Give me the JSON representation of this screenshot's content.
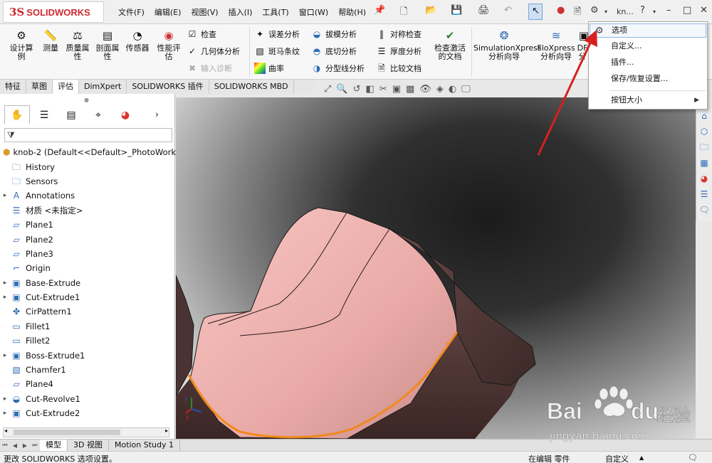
{
  "app": {
    "logo_ds": "3S",
    "logo_text": "SOLIDWORKS",
    "menus": [
      "文件(F)",
      "编辑(E)",
      "视图(V)",
      "插入(I)",
      "工具(T)",
      "窗口(W)",
      "帮助(H)"
    ],
    "user": "kn...",
    "help": "?"
  },
  "ribbon": {
    "big_tools": [
      {
        "label": "设计算\n例",
        "icon": "design-study-icon"
      },
      {
        "label": "测量",
        "icon": "measure-icon"
      },
      {
        "label": "质量属\n性",
        "icon": "mass-properties-icon"
      },
      {
        "label": "剖面属\n性",
        "icon": "section-properties-icon"
      },
      {
        "label": "传感器",
        "icon": "sensor-icon"
      },
      {
        "label": "性能评\n估",
        "icon": "performance-evaluation-icon"
      }
    ],
    "check_group": [
      {
        "label": "检查",
        "icon": "check-icon"
      },
      {
        "label": "几何体分析",
        "icon": "geometry-analysis-icon"
      },
      {
        "label": "输入诊断",
        "icon": "import-diagnostics-icon",
        "disabled": true
      }
    ],
    "analysis_col1": [
      {
        "label": "误差分析",
        "icon": "deviation-analysis-icon"
      },
      {
        "label": "斑马条纹",
        "icon": "zebra-stripes-icon"
      },
      {
        "label": "曲率",
        "icon": "curvature-icon"
      }
    ],
    "analysis_col2": [
      {
        "label": "拔模分析",
        "icon": "draft-analysis-icon"
      },
      {
        "label": "底切分析",
        "icon": "undercut-analysis-icon"
      },
      {
        "label": "分型线分析",
        "icon": "parting-line-analysis-icon"
      }
    ],
    "analysis_col3": [
      {
        "label": "对称检查",
        "icon": "symmetry-check-icon"
      },
      {
        "label": "厚度分析",
        "icon": "thickness-analysis-icon"
      },
      {
        "label": "比较文档",
        "icon": "compare-documents-icon"
      }
    ],
    "check_active_doc": "检查激活\n的文档",
    "simxpress": "SimulationXpress\n分析向导",
    "floxpress": "FloXpress\n分析向导",
    "dfm": "DF\n分"
  },
  "tabs": [
    {
      "label": "特征",
      "active": false
    },
    {
      "label": "草图",
      "active": false
    },
    {
      "label": "评估",
      "active": true
    },
    {
      "label": "DimXpert",
      "active": false
    },
    {
      "label": "SOLIDWORKS 插件",
      "active": false
    },
    {
      "label": "SOLIDWORKS MBD",
      "active": false
    }
  ],
  "feature_tree": {
    "root": "knob-2  (Default<<Default>_PhotoWork",
    "items": [
      {
        "label": "History",
        "icon": "history-folder-icon",
        "expandable": false
      },
      {
        "label": "Sensors",
        "icon": "sensors-folder-icon",
        "expandable": false
      },
      {
        "label": "Annotations",
        "icon": "annotations-icon",
        "expandable": true
      },
      {
        "label": "材质 <未指定>",
        "icon": "material-icon",
        "expandable": false
      },
      {
        "label": "Plane1",
        "icon": "plane-icon",
        "expandable": false
      },
      {
        "label": "Plane2",
        "icon": "plane-icon",
        "expandable": false
      },
      {
        "label": "Plane3",
        "icon": "plane-icon",
        "expandable": false
      },
      {
        "label": "Origin",
        "icon": "origin-icon",
        "expandable": false
      },
      {
        "label": "Base-Extrude",
        "icon": "extrude-feature-icon",
        "expandable": true
      },
      {
        "label": "Cut-Extrude1",
        "icon": "cut-extrude-icon",
        "expandable": true
      },
      {
        "label": "CirPattern1",
        "icon": "circular-pattern-icon",
        "expandable": false
      },
      {
        "label": "Fillet1",
        "icon": "fillet-icon",
        "expandable": false
      },
      {
        "label": "Fillet2",
        "icon": "fillet-icon",
        "expandable": false
      },
      {
        "label": "Boss-Extrude1",
        "icon": "boss-extrude-icon",
        "expandable": true
      },
      {
        "label": "Chamfer1",
        "icon": "chamfer-icon",
        "expandable": false
      },
      {
        "label": "Plane4",
        "icon": "plane-icon",
        "expandable": false
      },
      {
        "label": "Cut-Revolve1",
        "icon": "cut-revolve-icon",
        "expandable": true
      },
      {
        "label": "Cut-Extrude2",
        "icon": "cut-extrude-icon",
        "expandable": true
      }
    ]
  },
  "bottom_tabs": [
    {
      "label": "模型",
      "active": true
    },
    {
      "label": "3D 视图",
      "active": false
    },
    {
      "label": "Motion Study 1",
      "active": false
    }
  ],
  "status": {
    "message": "更改 SOLIDWORKS 选项设置。",
    "edit_mode": "在编辑 零件",
    "custom": "自定义"
  },
  "options_menu": {
    "items": [
      "选项",
      "自定义...",
      "插件...",
      "保存/恢复设置...",
      "按钮大小"
    ],
    "highlighted": "选项"
  },
  "watermark": {
    "brand": "Bai",
    "brand2": "du",
    "cn": "经验",
    "url": "jingyan.baidu.com"
  },
  "colors": {
    "brand_red": "#d0282e",
    "part_pink": "#f2b8b4",
    "highlight_edge": "#f08a1c",
    "arrow_red": "#d62020"
  }
}
